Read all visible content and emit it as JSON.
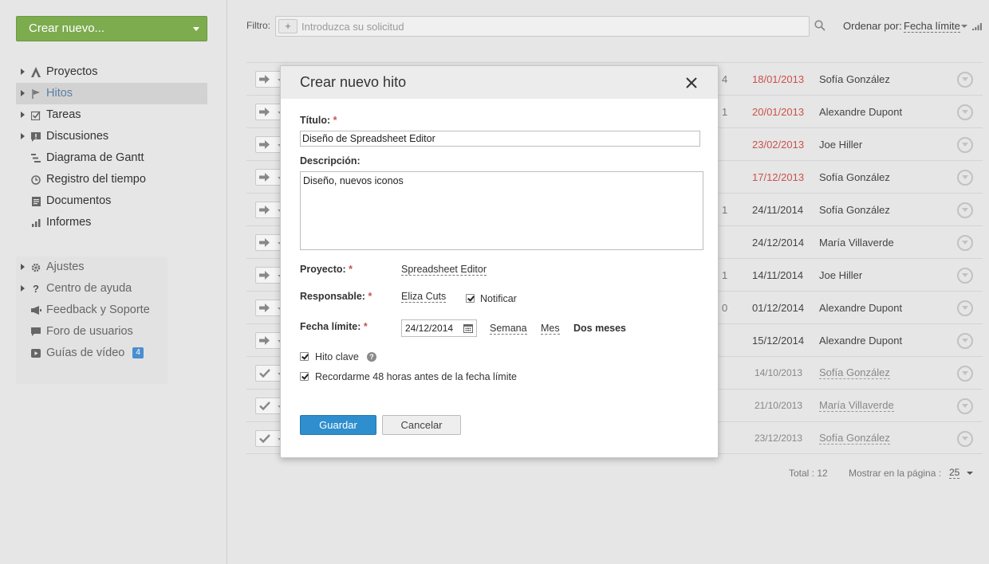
{
  "sidebar": {
    "create_label": "Crear nuevo...",
    "items": [
      {
        "label": "Proyectos"
      },
      {
        "label": "Hitos"
      },
      {
        "label": "Tareas"
      },
      {
        "label": "Discusiones"
      },
      {
        "label": "Diagrama de Gantt"
      },
      {
        "label": "Registro del tiempo"
      },
      {
        "label": "Documentos"
      },
      {
        "label": "Informes"
      }
    ],
    "secondary": [
      {
        "label": "Ajustes"
      },
      {
        "label": "Centro de ayuda"
      },
      {
        "label": "Feedback y Soporte"
      },
      {
        "label": "Foro de usuarios"
      },
      {
        "label": "Guías de vídeo",
        "badge": "4"
      }
    ]
  },
  "filter": {
    "label": "Filtro:",
    "placeholder": "Introduzca su solicitud",
    "sort_label": "Ordenar por:",
    "sort_value": "Fecha límite"
  },
  "milestones": [
    {
      "count": "4",
      "date": "18/01/2013",
      "person": "Sofía González",
      "status": "overdue"
    },
    {
      "count": "1",
      "date": "20/01/2013",
      "person": "Alexandre Dupont",
      "status": "overdue"
    },
    {
      "count": "",
      "date": "23/02/2013",
      "person": "Joe Hiller",
      "status": "overdue"
    },
    {
      "count": "",
      "date": "17/12/2013",
      "person": "Sofía González",
      "status": "overdue"
    },
    {
      "count": "1",
      "date": "24/11/2014",
      "person": "Sofía González",
      "status": "open"
    },
    {
      "count": "",
      "date": "24/12/2014",
      "person": "María Villaverde",
      "status": "open"
    },
    {
      "count": "1",
      "date": "14/11/2014",
      "person": "Joe Hiller",
      "status": "open"
    },
    {
      "count": "0",
      "date": "01/12/2014",
      "person": "Alexandre Dupont",
      "status": "open"
    },
    {
      "count": "",
      "date": "15/12/2014",
      "person": "Alexandre Dupont",
      "status": "open"
    },
    {
      "count": "",
      "date": "14/10/2013",
      "person": "Sofía González",
      "status": "closed"
    },
    {
      "count": "",
      "date": "21/10/2013",
      "person": "María Villaverde",
      "status": "closed"
    },
    {
      "count": "",
      "date": "23/12/2013",
      "person": "Sofía González",
      "status": "closed"
    }
  ],
  "footer": {
    "total": "Total : 12",
    "per_page_label": "Mostrar en la página :",
    "per_page_value": "25"
  },
  "modal": {
    "title": "Crear nuevo hito",
    "title_label": "Título:",
    "title_value": "Diseño de Spreadsheet Editor",
    "description_label": "Descripción:",
    "description_value": "Diseño, nuevos iconos",
    "project_label": "Proyecto:",
    "project_value": "Spreadsheet Editor",
    "responsible_label": "Responsable:",
    "responsible_value": "Eliza Cuts",
    "notify_label": "Notificar",
    "deadline_label": "Fecha límite:",
    "deadline_value": "24/12/2014",
    "quick_week": "Semana",
    "quick_month": "Mes",
    "quick_two_months": "Dos meses",
    "key_label": "Hito clave",
    "remind_label": "Recordarme 48 horas antes de la fecha límite",
    "save_label": "Guardar",
    "cancel_label": "Cancelar",
    "required_mark": "*"
  },
  "colors": {
    "accent_green": "#7cac4e",
    "accent_blue": "#2f8ecd",
    "overdue_red": "#c9524a",
    "active_link": "#5a7ea6"
  }
}
